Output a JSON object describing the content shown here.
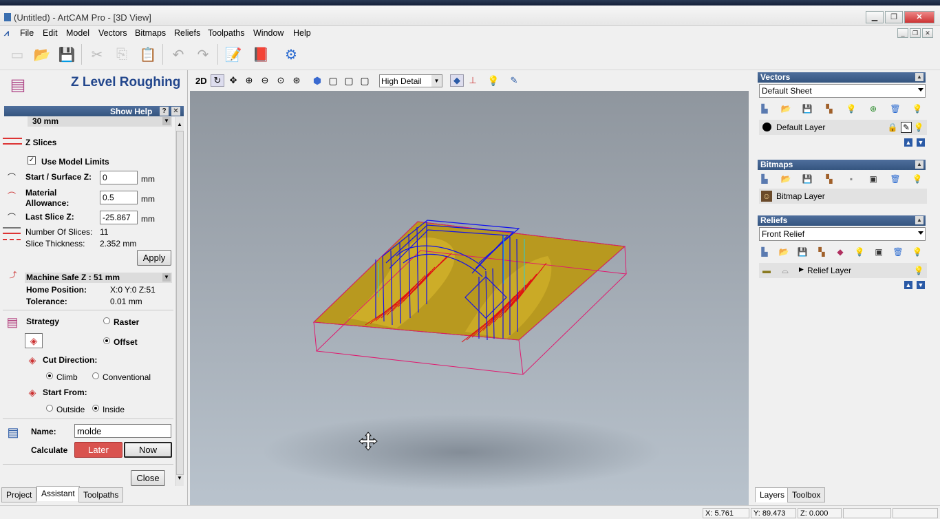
{
  "window": {
    "title": "(Untitled) - ArtCAM Pro - [3D View]"
  },
  "menu": [
    "File",
    "Edit",
    "Model",
    "Vectors",
    "Bitmaps",
    "Reliefs",
    "Toolpaths",
    "Window",
    "Help"
  ],
  "view_toolbar": {
    "mode_2d": "2D",
    "detail_select": "High Detail"
  },
  "left_panel": {
    "title": "Z Level Roughing",
    "show_help": "Show Help",
    "help_btn": "?",
    "close_x": "✕",
    "tool_value": "30 mm",
    "z_slices": "Z Slices",
    "use_model_limits": "Use Model Limits",
    "start_surface_label": "Start / Surface Z:",
    "start_surface_value": "0",
    "unit_mm": "mm",
    "material_allowance_label_1": "Material",
    "material_allowance_label_2": "Allowance:",
    "material_allowance_value": "0.5",
    "last_slice_label": "Last Slice Z:",
    "last_slice_value": "-25.867",
    "num_slices_label": "Number Of Slices:",
    "num_slices_value": "11",
    "slice_thickness_label": "Slice Thickness:",
    "slice_thickness_value": "2.352 mm",
    "apply": "Apply",
    "machine_safe_z": "Machine Safe Z : 51 mm",
    "home_position_label": "Home Position:",
    "home_position_value": "X:0 Y:0 Z:51",
    "tolerance_label": "Tolerance:",
    "tolerance_value": "0.01 mm",
    "strategy": "Strategy",
    "raster": "Raster",
    "offset": "Offset",
    "cut_direction": "Cut Direction:",
    "climb": "Climb",
    "conventional": "Conventional",
    "start_from": "Start From:",
    "outside": "Outside",
    "inside": "Inside",
    "name_label": "Name:",
    "name_value": "molde",
    "calculate": "Calculate",
    "later": "Later",
    "now": "Now",
    "close": "Close",
    "tabs": [
      "Project",
      "Assistant",
      "Toolpaths"
    ]
  },
  "right_panel": {
    "vectors_title": "Vectors",
    "vectors_sheet": "Default Sheet",
    "default_layer": "Default Layer",
    "bitmaps_title": "Bitmaps",
    "bitmap_layer": "Bitmap Layer",
    "reliefs_title": "Reliefs",
    "relief_select": "Front Relief",
    "relief_layer": "Relief Layer",
    "tabs": [
      "Layers",
      "Toolbox"
    ]
  },
  "status": {
    "x": "X: 5.761",
    "y": "Y: 89.473",
    "z": "Z: 0.000"
  },
  "colors": {
    "panel_header": "#3e5f8e",
    "later_button": "#d9534f",
    "model_surface": "#b89a1e",
    "toolpath_blue": "#1010ee",
    "toolpath_red": "#e01010",
    "bounding_box": "#e0186e"
  }
}
